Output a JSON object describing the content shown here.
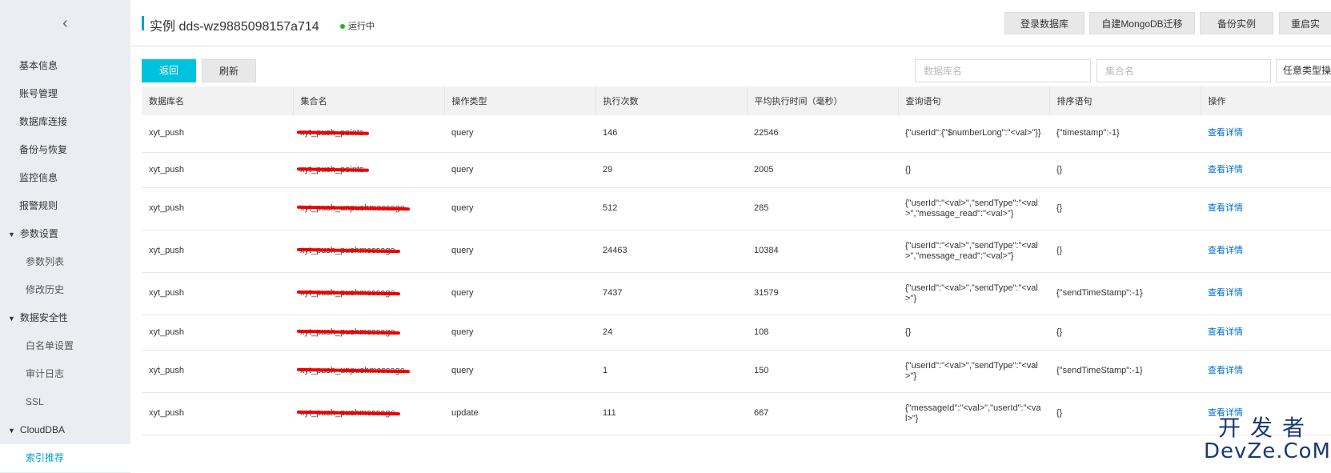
{
  "sidebar": {
    "back_icon": "chevron-left-icon",
    "items": [
      {
        "label": "基本信息"
      },
      {
        "label": "账号管理"
      },
      {
        "label": "数据库连接"
      },
      {
        "label": "备份与恢复"
      },
      {
        "label": "监控信息"
      },
      {
        "label": "报警规则"
      }
    ],
    "group_params": {
      "label": "参数设置",
      "children": [
        "参数列表",
        "修改历史"
      ]
    },
    "group_security": {
      "label": "数据安全性",
      "children": [
        "白名单设置",
        "审计日志",
        "SSL"
      ]
    },
    "group_clouddba": {
      "label": "CloudDBA",
      "children": [
        "索引推荐"
      ]
    }
  },
  "header": {
    "title": "实例 dds-wz9885098157a714",
    "status": "运行中",
    "buttons": [
      "登录数据库",
      "自建MongoDB迁移",
      "备份实例",
      "重启实"
    ]
  },
  "toolbar": {
    "back_label": "返回",
    "refresh_label": "刷新",
    "db_placeholder": "数据库名",
    "coll_placeholder": "集合名",
    "op_select": "任意类型操作"
  },
  "table": {
    "columns": [
      "数据库名",
      "集合名",
      "操作类型",
      "执行次数",
      "平均执行时间（毫秒）",
      "查询语句",
      "排序语句",
      "操作"
    ],
    "rows": [
      {
        "db": "xyt_push",
        "coll": "xyt_push_points",
        "op": "query",
        "count": "146",
        "avg": "22546",
        "query": "{\"userId\":{\"$numberLong\":\"<val>\"}}",
        "sort": "{\"timestamp\":-1}",
        "action": "查看详情"
      },
      {
        "db": "xyt_push",
        "coll": "xyt_push_points",
        "op": "query",
        "count": "29",
        "avg": "2005",
        "query": "{}",
        "sort": "{}",
        "action": "查看详情"
      },
      {
        "db": "xyt_push",
        "coll": "xyt_push_unpushmessage",
        "op": "query",
        "count": "512",
        "avg": "285",
        "query": "{\"userId\":\"<val>\",\"sendType\":\"<val>\",\"message_read\":\"<val>\"}",
        "sort": "{}",
        "action": "查看详情"
      },
      {
        "db": "xyt_push",
        "coll": "xyt_push_pushmessage",
        "op": "query",
        "count": "24463",
        "avg": "10384",
        "query": "{\"userId\":\"<val>\",\"sendType\":\"<val>\",\"message_read\":\"<val>\"}",
        "sort": "{}",
        "action": "查看详情"
      },
      {
        "db": "xyt_push",
        "coll": "xyt_push_pushmessage",
        "op": "query",
        "count": "7437",
        "avg": "31579",
        "query": "{\"userId\":\"<val>\",\"sendType\":\"<val>\"}",
        "sort": "{\"sendTimeStamp\":-1}",
        "action": "查看详情"
      },
      {
        "db": "xyt_push",
        "coll": "xyt_push_pushmessage",
        "op": "query",
        "count": "24",
        "avg": "108",
        "query": "{}",
        "sort": "{}",
        "action": "查看详情"
      },
      {
        "db": "xyt_push",
        "coll": "xyt_push_unpushmessage",
        "op": "query",
        "count": "1",
        "avg": "150",
        "query": "{\"userId\":\"<val>\",\"sendType\":\"<val>\"}",
        "sort": "{\"sendTimeStamp\":-1}",
        "action": "查看详情"
      },
      {
        "db": "xyt_push",
        "coll": "xyt_push_pushmessage",
        "op": "update",
        "count": "111",
        "avg": "667",
        "query": "{\"messageId\":\"<val>\",\"userId\":\"<val>\"}",
        "sort": "{}",
        "action": "查看详情"
      }
    ]
  },
  "watermark": {
    "cn": "开发者",
    "en": "DevZe.CoM"
  }
}
